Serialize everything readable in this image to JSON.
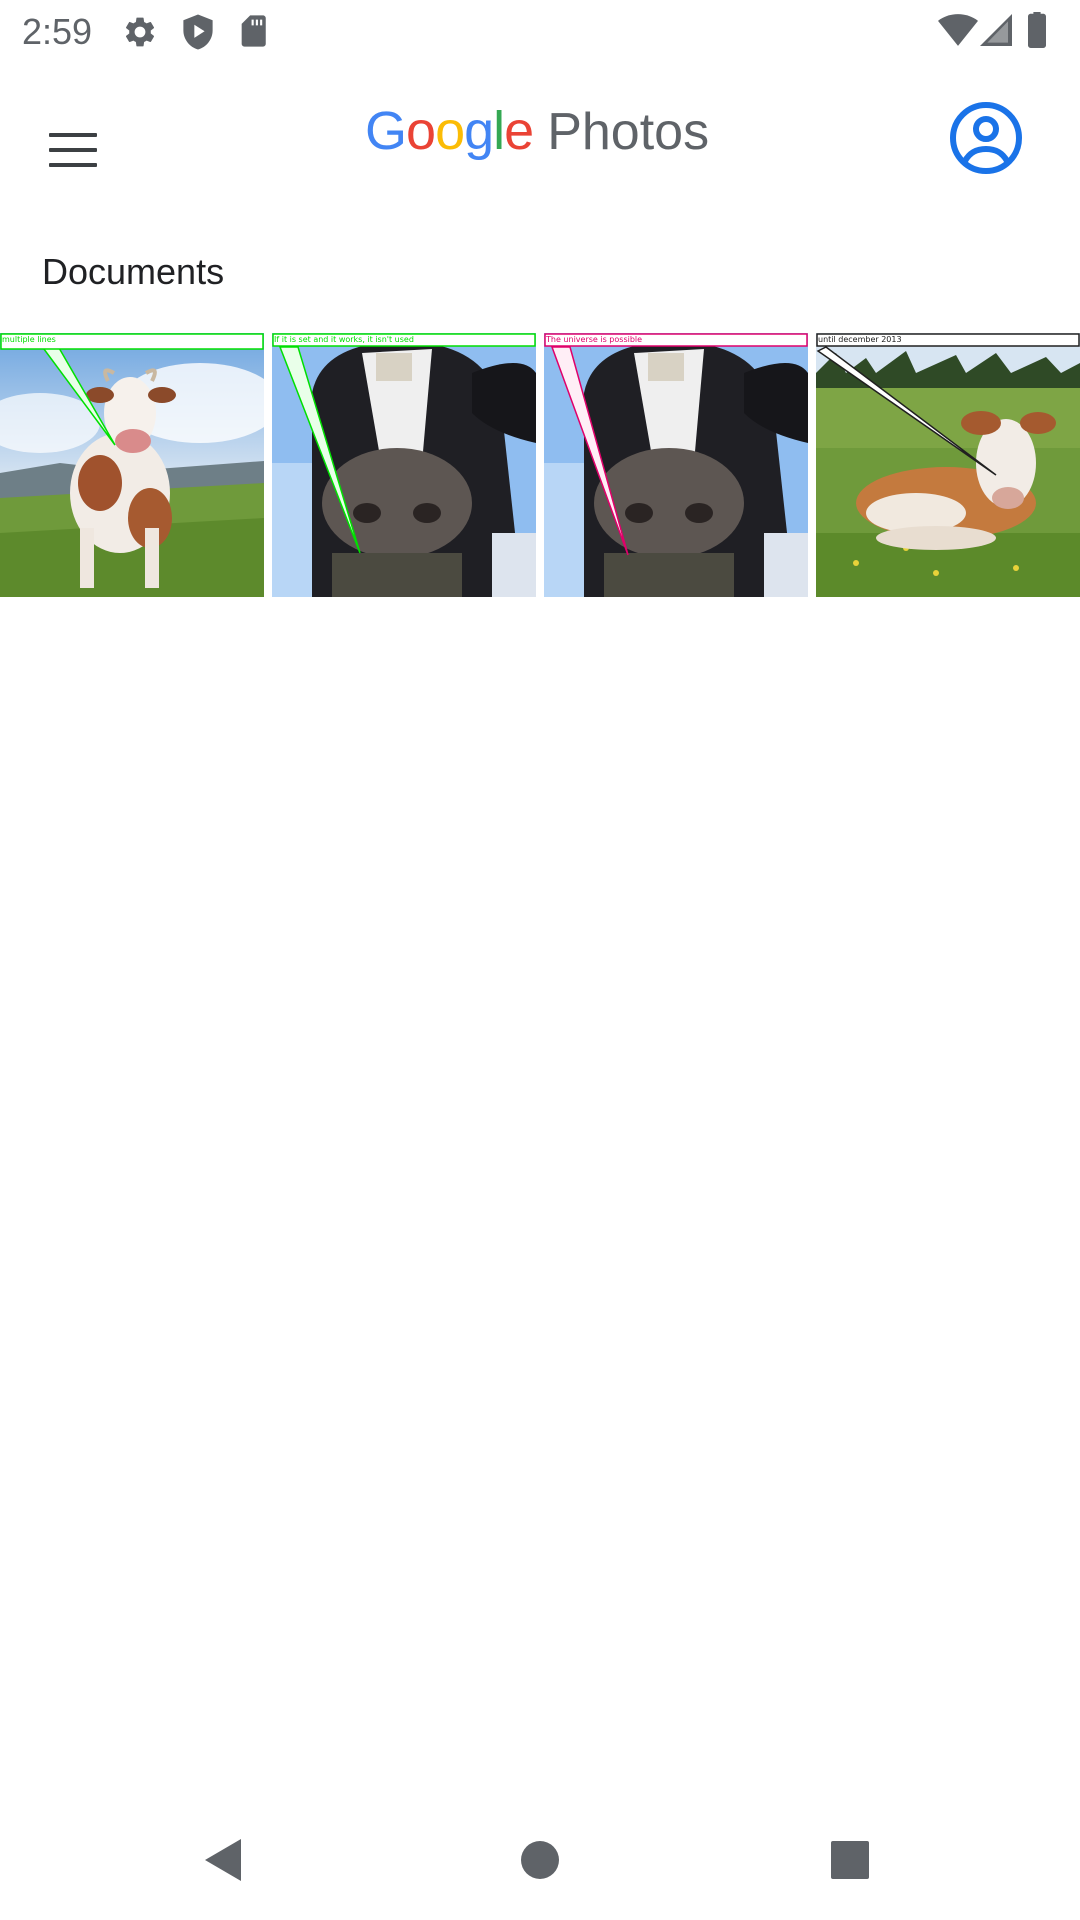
{
  "status_bar": {
    "time": "2:59",
    "icons": [
      "settings-icon",
      "shield-icon",
      "sd-card-icon",
      "wifi-icon",
      "cell-signal-icon",
      "battery-icon"
    ]
  },
  "app_bar": {
    "logo_google": [
      "G",
      "o",
      "o",
      "g",
      "l",
      "e"
    ],
    "logo_google_colors": [
      "#4285F4",
      "#EA4335",
      "#FBBC05",
      "#4285F4",
      "#34A853",
      "#EA4335"
    ],
    "logo_photos": "Photos",
    "menu_icon": "hamburger-menu-icon",
    "account_icon": "account-circle-icon",
    "accent_color": "#1a73e8"
  },
  "section": {
    "title": "Documents"
  },
  "photos": [
    {
      "caption": "multiple lines",
      "caption_color": "#00e000"
    },
    {
      "caption": "If it is set and it works, it isn't used",
      "caption_color": "#00e000"
    },
    {
      "caption": "The universe is possible",
      "caption_color": "#e0006a"
    },
    {
      "caption": "until december 2013",
      "caption_color": "#202020"
    }
  ],
  "nav_bar": {
    "icons": [
      "back-icon",
      "home-icon",
      "recents-icon"
    ]
  }
}
